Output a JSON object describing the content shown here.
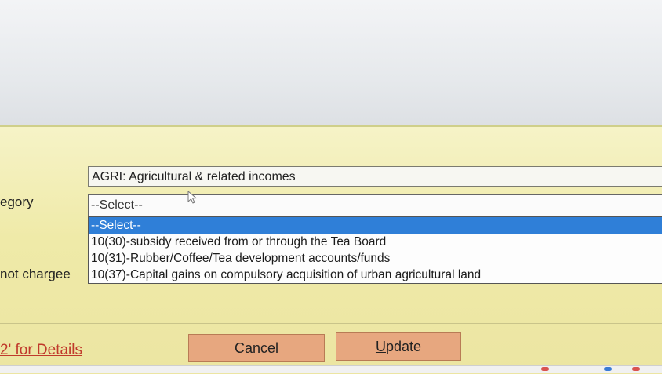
{
  "labels": {
    "category_partial": "egory",
    "not_charged_partial": "not chargee"
  },
  "fields": {
    "income_head": "AGRI: Agricultural & related incomes"
  },
  "select": {
    "current_value": "--Select--",
    "options": [
      "--Select--",
      "10(30)-subsidy received from or through the Tea Board",
      "10(31)-Rubber/Coffee/Tea development accounts/funds",
      "10(37)-Capital gains on compulsory acquisition of urban agricultural land"
    ],
    "selected_index": 0
  },
  "links": {
    "details": "2' for Details"
  },
  "buttons": {
    "cancel": "Cancel",
    "update": "Update"
  },
  "colors": {
    "panel": "#efeaa8",
    "selection": "#2f7fd8",
    "button": "#e7a77f",
    "link": "#c0392b"
  },
  "icons": {
    "cursor": "mouse-pointer-icon"
  }
}
